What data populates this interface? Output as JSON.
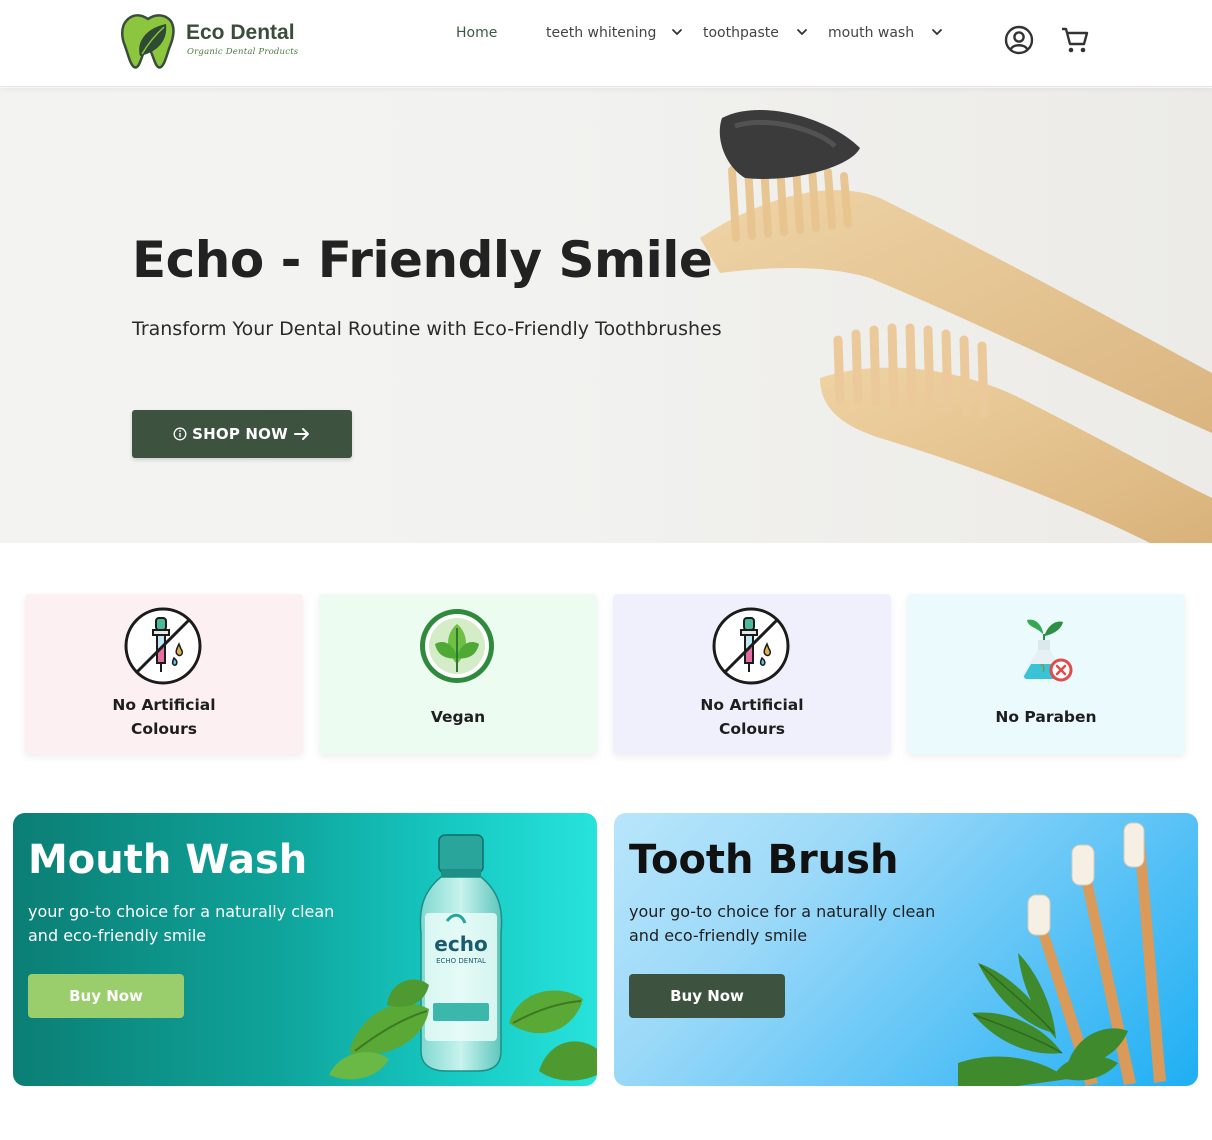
{
  "brand": {
    "name": "Eco Dental",
    "tagline": "Organic Dental Products"
  },
  "nav": {
    "home": "Home",
    "items": [
      {
        "label": "teeth whitening"
      },
      {
        "label": "toothpaste"
      },
      {
        "label": "mouth wash"
      }
    ]
  },
  "header_icons": [
    "account-icon",
    "cart-icon"
  ],
  "hero": {
    "title": "Echo - Friendly Smile",
    "subtitle": "Transform Your Dental Routine with Eco-Friendly Toothbrushes",
    "button_label": "SHOP NOW"
  },
  "features": [
    {
      "line1": "No Artificial",
      "line2": "Colours",
      "bg": "#fdf0f3",
      "icon": "no-dropper-icon"
    },
    {
      "line1": "Vegan",
      "line2": "",
      "bg": "#ecfcf1",
      "icon": "vegan-leaf-icon"
    },
    {
      "line1": "No Artificial",
      "line2": "Colours",
      "bg": "#f0f0fc",
      "icon": "no-dropper-icon"
    },
    {
      "line1": "No Paraben",
      "line2": "",
      "bg": "#ebfafd",
      "icon": "no-paraben-flask-icon"
    }
  ],
  "promos": [
    {
      "title": "Mouth Wash",
      "desc": "your go-to choice for a naturally clean and eco-friendly smile",
      "button": "Buy Now",
      "button_bg": "#9acd6b"
    },
    {
      "title": "Tooth Brush",
      "desc": "your go-to choice for a naturally clean and eco-friendly smile",
      "button": "Buy Now",
      "button_bg": "#3d5340"
    }
  ],
  "bottle_label": {
    "brand": "echo",
    "name": "ECHO DENTAL"
  },
  "colors": {
    "primary_dark": "#3d5340",
    "accent_green": "#9acd6b",
    "teal": "#19b8b0",
    "sky": "#22b6f5"
  }
}
